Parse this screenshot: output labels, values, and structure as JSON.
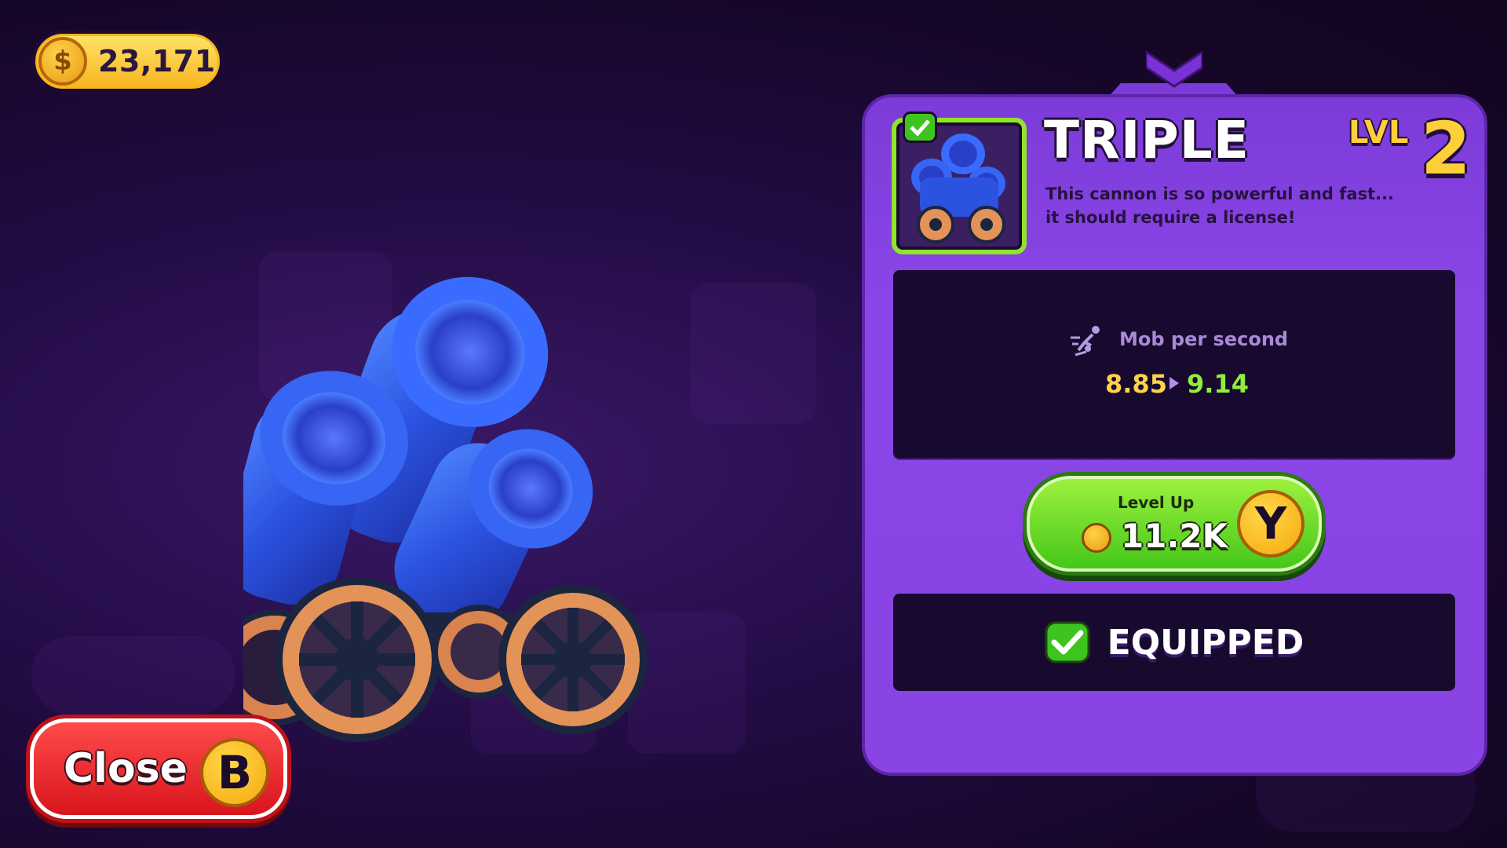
{
  "wallet": {
    "coins": "23,171",
    "coin_icon": "coin-icon",
    "coin_symbol": "$"
  },
  "item": {
    "name": "TRIPLE",
    "level_label": "LVL",
    "level": "2",
    "description": "This cannon is so powerful and fast... it should require a license!",
    "owned": true
  },
  "stat": {
    "icon": "mob-speed-icon",
    "label": "Mob per second",
    "current": "8.85",
    "next": "9.14"
  },
  "level_up": {
    "title": "Level Up",
    "price": "11.2K",
    "key": "Y"
  },
  "equipped": {
    "label": "EQUIPPED"
  },
  "close": {
    "label": "Close",
    "key": "B"
  },
  "colors": {
    "panel": "#8a44e4",
    "stat_current": "#ffd24a",
    "stat_next": "#8ef03c",
    "close": "#e0181f",
    "level_up": "#5fd424"
  }
}
